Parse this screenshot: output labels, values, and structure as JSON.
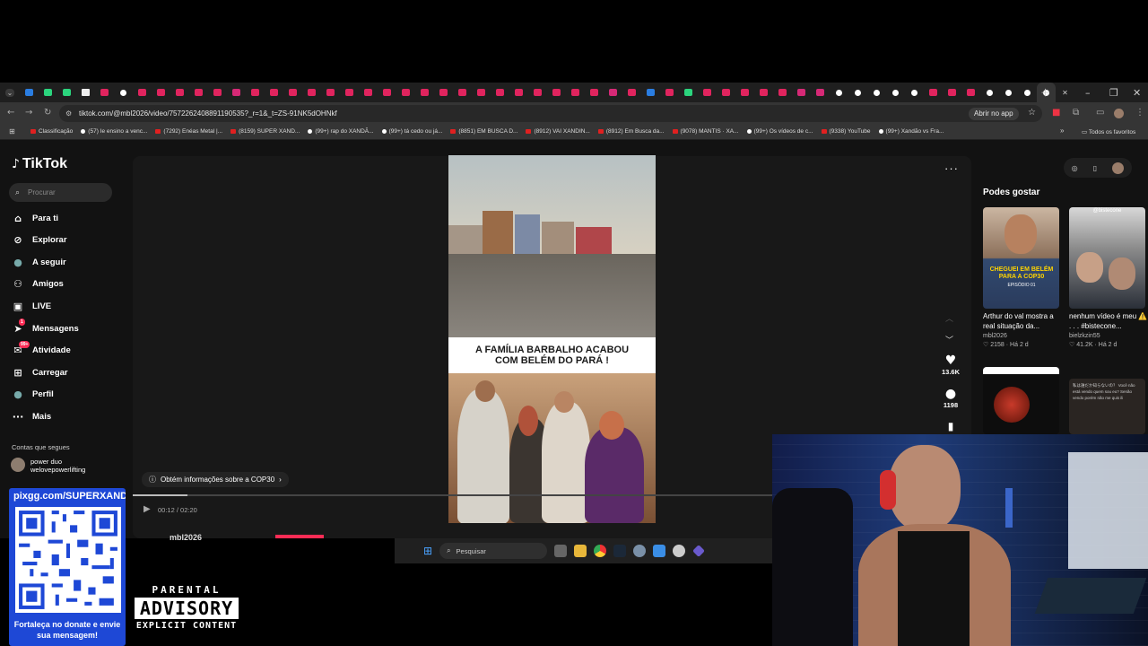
{
  "browser": {
    "url": "tiktok.com/@mbl2026/video/7572262408891190535?_r=1&_t=ZS-91NK5dOHNkf",
    "open_in_app": "Abrir no app",
    "bookmarks": [
      "Classificação",
      "(57) Ie ensino a venc...",
      "(7292) Enéas Metal |...",
      "(8159) SUPER XAND...",
      "(99+) rap do XANDÃ...",
      "(99+) tá cedo ou já...",
      "(8851) EM BUSCA D...",
      "(8912) VAI XANDIN...",
      "(8912) Em Busca da...",
      "(9078) MANTIS · XA...",
      "(99+) Os vídeos de c...",
      "(9338) YouTube",
      "(99+) Xandão vs Fra..."
    ],
    "all_favorites": "Todos os favoritos"
  },
  "tiktok": {
    "logo": "TikTok",
    "search_placeholder": "Procurar",
    "nav": [
      {
        "label": "Para ti",
        "icon": "home-icon"
      },
      {
        "label": "Explorar",
        "icon": "compass-icon"
      },
      {
        "label": "A seguir",
        "icon": "following-avatar-icon"
      },
      {
        "label": "Amigos",
        "icon": "friends-icon"
      },
      {
        "label": "LIVE",
        "icon": "live-icon"
      },
      {
        "label": "Mensagens",
        "icon": "messages-icon",
        "badge": "1"
      },
      {
        "label": "Atividade",
        "icon": "activity-icon",
        "badge": "99+"
      },
      {
        "label": "Carregar",
        "icon": "upload-icon"
      },
      {
        "label": "Perfil",
        "icon": "profile-icon"
      },
      {
        "label": "Mais",
        "icon": "more-icon"
      }
    ],
    "following_title": "Contas que segues",
    "following": [
      {
        "name": "power duo",
        "handle": "welovepowerlifting"
      }
    ],
    "video": {
      "banner_line1": "A FAMÍLIA BARBALHO ACABOU",
      "banner_line2": "COM BELÉM DO PARÁ !",
      "info_chip": "Obtém informações sobre a COP30",
      "time": "00:12 / 02:20",
      "progress": 0.086,
      "author": "mbl2026"
    },
    "actions": {
      "likes": "13.6K",
      "comments": "1198"
    },
    "may_like_title": "Podes gostar",
    "recommendations": [
      {
        "title": "Arthur do val mostra a real situação da...",
        "author": "mbl2026",
        "views": "2158",
        "age": "Há 2 d",
        "overlay": "CHEGUEI EM BELÉM PARA A COP30",
        "overlay_sub": "EPISÓDIO 01"
      },
      {
        "title": "nenhum vídeo é meu ⚠️ . . . #bistecone...",
        "author": "bielzkzin55",
        "views": "41.2K",
        "age": "Há 2 d",
        "overlay": "@bistecone"
      },
      {
        "title": "",
        "overlay": ""
      },
      {
        "title": "",
        "overlay": "私は誰だか知らないの？ Você não está vendo quem sou eu? Senão vendo porém não me quis ili"
      }
    ]
  },
  "taskbar": {
    "search": "Pesquisar"
  },
  "overlay": {
    "donate_url": "pixgg.com/SUPERXANDA",
    "donate_text": "Fortaleça no donate e envie sua mensagem!",
    "pa_line1": "PARENTAL",
    "pa_line2": "ADVISORY",
    "pa_line3": "EXPLICIT CONTENT"
  },
  "colors": {
    "tiktok_red": "#fe2c55",
    "donate_blue": "#1e48d6"
  }
}
